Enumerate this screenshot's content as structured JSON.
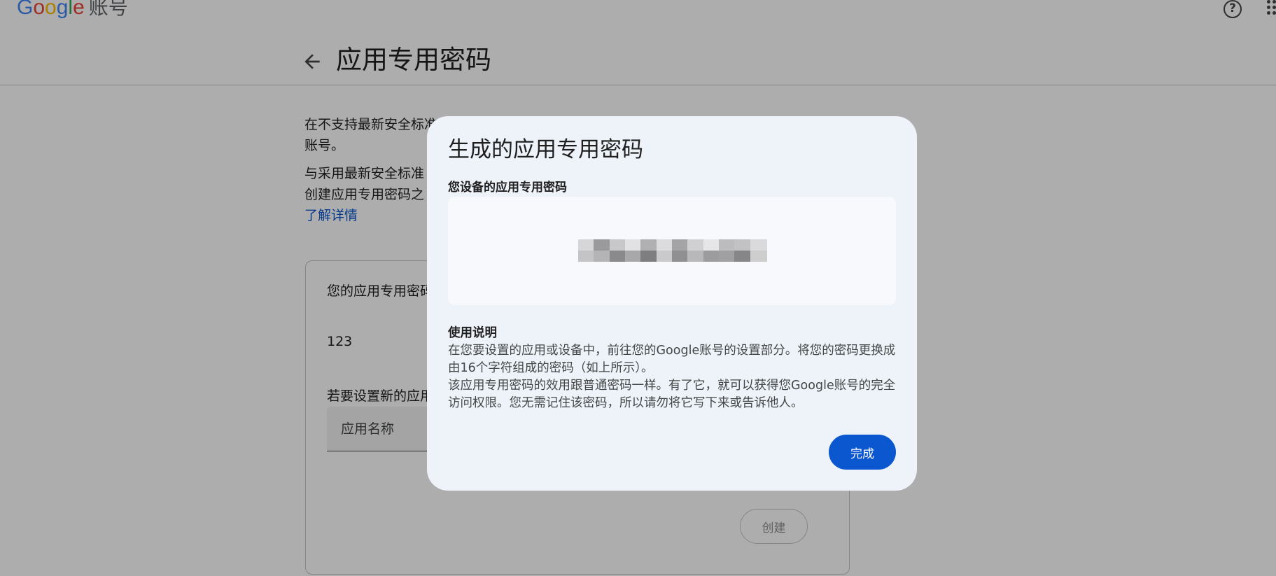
{
  "header": {
    "logo_google": "Google",
    "logo_account": "账号",
    "help_icon": "help-circle-icon",
    "apps_icon": "apps-grid-icon"
  },
  "page": {
    "back_icon": "arrow-left-icon",
    "title": "应用专用密码",
    "intro_line1": "在不支持最新安全标准",
    "intro_line2": "账号。",
    "intro_line3": "与采用最新安全标准",
    "intro_line4": "创建应用专用密码之",
    "learn_more": "了解详情"
  },
  "card": {
    "heading": "您的应用专用密码",
    "app_entry": "123",
    "new_prompt": "若要设置新的应用",
    "app_name_placeholder": "应用名称",
    "create_label": "创建"
  },
  "dialog": {
    "title": "生成的应用专用密码",
    "password_label": "您设备的应用专用密码",
    "password_value": "(已模糊处理)",
    "usage_heading": "使用说明",
    "usage_p1": "在您要设置的应用或设备中，前往您的Google账号的设置部分。将您的密码更换成由16个字符组成的密码（如上所示）。",
    "usage_p2": "该应用专用密码的效用跟普通密码一样。有了它，就可以获得您Google账号的完全访问权限。您无需记住该密码，所以请勿将它写下来或告诉他人。",
    "done_label": "完成"
  },
  "colors": {
    "primary": "#0b57d0",
    "dialog_bg": "#eef2f9",
    "scrim": "rgba(0,0,0,0.32)"
  }
}
